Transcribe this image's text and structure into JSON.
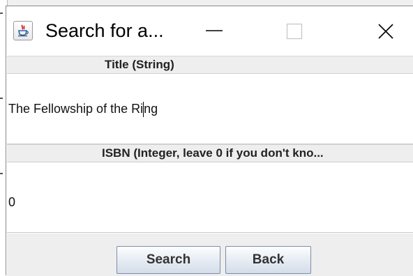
{
  "window": {
    "title": "Search for a...",
    "icon": "java-cup-icon"
  },
  "fields": {
    "title_header": "Title (String)",
    "title_value_before_caret": "The Fellowship of the Ri",
    "title_value_after_caret": "ng",
    "isbn_header": "ISBN (Integer, leave 0 if you don't kno...",
    "isbn_value": "0"
  },
  "buttons": {
    "search_label": "Search",
    "back_label": "Back"
  },
  "colors": {
    "button_border": "#7a8ea8",
    "header_background": "#eeeeee",
    "java_icon_red": "#d0021b",
    "java_icon_blue": "#2f5f9e"
  }
}
